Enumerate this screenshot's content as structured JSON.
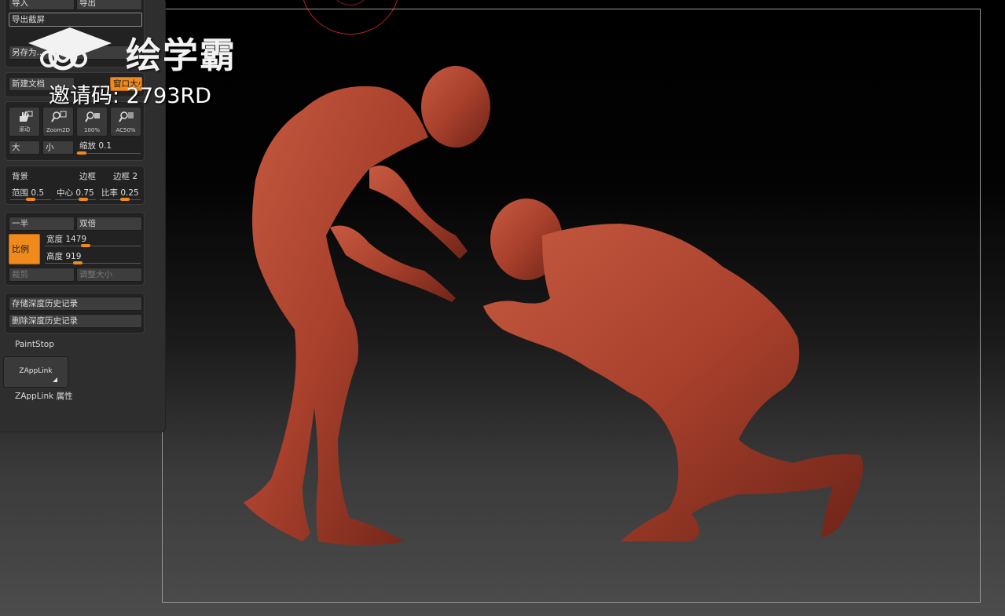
{
  "canvas": {
    "figure_color": "#a8402c",
    "frame_color": "#9a9a9a",
    "brush_ring_color": "#b2222a"
  },
  "panel": {
    "export_group": {
      "import_label": "导入",
      "export_label": "导出",
      "export_screenshot_label": "导出截屏",
      "save_as_label": "另存为..."
    },
    "document_group": {
      "new_document_label": "新建文档",
      "window_size_label": "窗口大小"
    },
    "view_group": {
      "icons": [
        {
          "name": "hand-pan-icon",
          "caption": "滚动"
        },
        {
          "name": "zoom2d-icon",
          "caption": "Zoom2D"
        },
        {
          "name": "zoom-100-icon",
          "caption": "100%"
        },
        {
          "name": "antialias-50-icon",
          "caption": "AC50%"
        }
      ],
      "large_label": "大",
      "small_label": "小",
      "zoom_label": "缩放",
      "zoom_value": "0.1",
      "zoom_level": 0.1
    },
    "background_group": {
      "background_label": "背景",
      "border_label": "边框",
      "border2_label": "边框 2",
      "range_label": "范围",
      "range_value": "0.5",
      "center_label": "中心",
      "center_value": "0.75",
      "rate_label": "比率",
      "rate_value": "0.25"
    },
    "size_group": {
      "half_label": "一半",
      "double_label": "双倍",
      "ratio_label": "比例",
      "width_label": "宽度",
      "width_value": "1479",
      "height_label": "高度",
      "height_value": "919",
      "crop_label": "裁剪",
      "resize_label": "调整大小"
    },
    "history_group": {
      "store_label": "存储深度历史记录",
      "delete_label": "删除深度历史记录"
    },
    "paintstop_label": "PaintStop",
    "zapplink_button_label": "ZAppLink",
    "zapplink_props_label": "ZAppLink 属性"
  },
  "watermark": {
    "brand": "绘学霸",
    "invite_code": "邀请码: 2793RD"
  }
}
